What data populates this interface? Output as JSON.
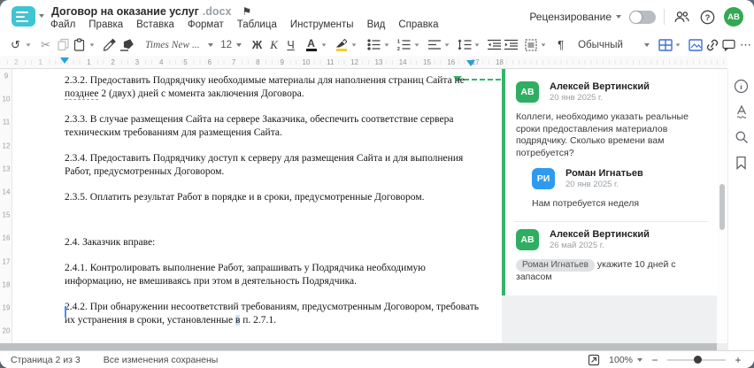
{
  "header": {
    "title": "Договор на оказание услуг",
    "ext": ".docx",
    "flag_icon": "⚑",
    "menu": [
      "Файл",
      "Правка",
      "Вставка",
      "Формат",
      "Таблица",
      "Инструменты",
      "Вид",
      "Справка"
    ],
    "review_label": "Рецензирование",
    "avatar_initials": "АВ"
  },
  "toolbar": {
    "undo_icon": "↺",
    "cut_icon": "✂",
    "font_name": "Times New ...",
    "font_size": "12",
    "bold_label": "Ж",
    "italic_label": "К",
    "underline_label": "Ч",
    "font_color_letter": "А",
    "pilcrow": "¶",
    "style_name": "Обычный",
    "more_label": "⋯"
  },
  "ruler": {
    "h_margin_numbers": [
      "1",
      "2"
    ],
    "h_main_numbers": [
      "1",
      "2",
      "3",
      "4",
      "5",
      "6",
      "7",
      "8",
      "9",
      "10",
      "11",
      "12",
      "13",
      "14",
      "15",
      "16",
      "17",
      "18"
    ],
    "v_numbers": [
      "9",
      "10",
      "11",
      "12",
      "13",
      "14",
      "15",
      "16",
      "17",
      "18",
      "19",
      "20"
    ]
  },
  "document": {
    "p1": {
      "l1": "2.3.2. Предоставить Подрядчику необходимые материалы для наполнения страниц Сайта не",
      "l2_u": "позднее",
      "l2_rest": " 2 (двух) дней с момента заключения Договора."
    },
    "p2": {
      "l1": "2.3.3. В случае размещения Сайта на сервере Заказчика, обеспечить соответствие сервера",
      "l2": "техническим требованиям для размещения Сайта."
    },
    "p3": {
      "l1": "2.3.4. Предоставить Подрядчику доступ к серверу для размещения Сайта и для выполнения",
      "l2": "Работ, предусмотренных Договором."
    },
    "p4": {
      "l1": "2.3.5. Оплатить результат Работ в порядке и в сроки, предусмотренные Договором."
    },
    "p5": {
      "l1": "2.4. Заказчик вправе:"
    },
    "p6": {
      "l1": "2.4.1. Контролировать выполнение Работ, запрашивать у Подрядчика необходимую",
      "l2": "информацию, не вмешиваясь при этом в деятельность Подрядчика."
    },
    "p7": {
      "l1": "2.4.2. При обнаружении несоответствий требованиям, предусмотренным Договором, требовать",
      "l2_pre": "их устранения в сроки, установленные ",
      "l2_hl": "в",
      "l2_post": " п. 2.7.1."
    }
  },
  "comments_panel": {
    "c1": {
      "initials": "АВ",
      "name": "Алексей Вертинский",
      "date": "20 янв 2025 г.",
      "body": "Коллеги, необходимо указать реальные сроки предоставления материалов подрядчику. Сколько времени вам потребуется?"
    },
    "c2": {
      "initials": "РИ",
      "name": "Роман Игнатьев",
      "date": "20 янв 2025 г.",
      "body": "Нам потребуется неделя"
    },
    "c3": {
      "initials": "АВ",
      "name": "Алексей Вертинский",
      "date": "26 май 2025 г.",
      "mention": "Роман Игнатьев",
      "body": "укажите 10 дней с запасом"
    }
  },
  "status_bar": {
    "page_indicator": "Страница 2 из 3",
    "save_status": "Все изменения сохранены",
    "zoom_value": "100%",
    "zoom_out": "−",
    "zoom_in": "+"
  },
  "colors": {
    "brand_teal": "#3fc4d4",
    "accent_green": "#2fae62",
    "accent_blue": "#2e9af0",
    "toolbar_blue": "#3f6fd8",
    "ruler_marker_blue": "#2b9fd8"
  }
}
